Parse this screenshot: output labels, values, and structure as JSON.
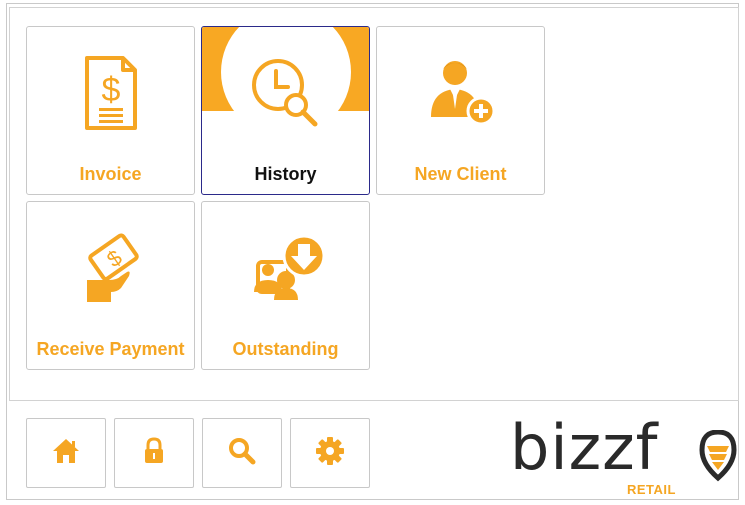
{
  "tiles": [
    {
      "label": "Invoice",
      "icon": "invoice-icon"
    },
    {
      "label": "History",
      "icon": "history-icon",
      "active": true
    },
    {
      "label": "New Client",
      "icon": "new-client-icon"
    },
    {
      "label": "Receive Payment",
      "icon": "receive-payment-icon"
    },
    {
      "label": "Outstanding",
      "icon": "outstanding-icon"
    }
  ],
  "toolbar": [
    {
      "icon": "home-icon"
    },
    {
      "icon": "lock-icon"
    },
    {
      "icon": "search-icon"
    },
    {
      "icon": "gear-icon"
    }
  ],
  "logo": {
    "wordmark": "bizzf",
    "subtitle": "RETAIL"
  },
  "colors": {
    "accent": "#f5a623",
    "active_border": "#2b2a8a",
    "text_dark": "#111111"
  }
}
